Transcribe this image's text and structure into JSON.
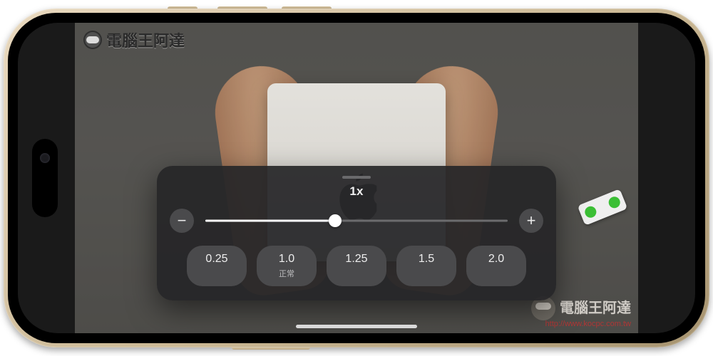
{
  "watermark": {
    "top_left_text": "電腦王阿達",
    "bottom_right_text": "電腦王阿達",
    "bottom_right_url": "http://www.kocpc.com.tw"
  },
  "speed_panel": {
    "current_label": "1x",
    "minus_label": "−",
    "plus_label": "+",
    "slider_fill_percent": 43,
    "presets": [
      {
        "value": "0.25",
        "sub": ""
      },
      {
        "value": "1.0",
        "sub": "正常"
      },
      {
        "value": "1.25",
        "sub": ""
      },
      {
        "value": "1.5",
        "sub": ""
      },
      {
        "value": "2.0",
        "sub": ""
      }
    ]
  }
}
